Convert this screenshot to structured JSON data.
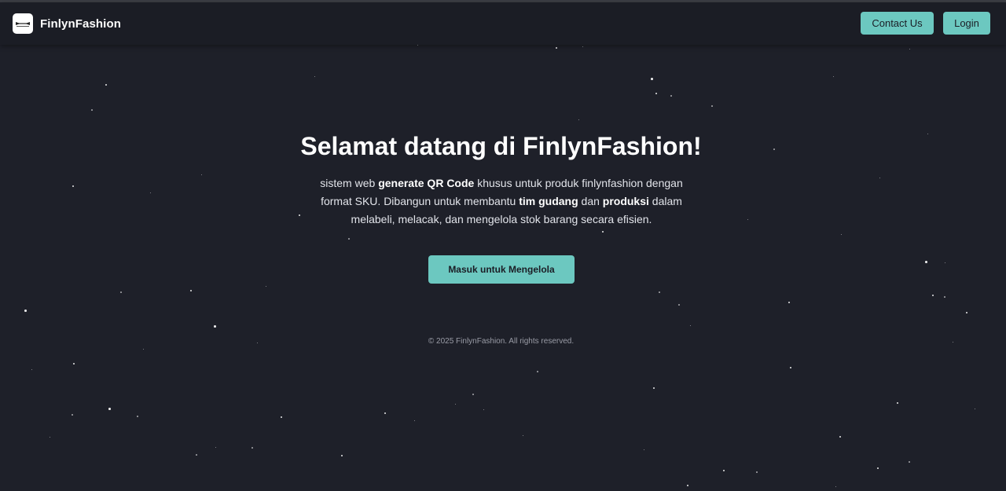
{
  "navbar": {
    "brand_name": "FinlynFashion",
    "logo_icon": "brand-logo-icon",
    "contact_label": "Contact Us",
    "login_label": "Login"
  },
  "hero": {
    "title": "Selamat datang di FinlynFashion!",
    "desc": {
      "t1": "sistem web ",
      "b1": "generate QR Code",
      "t2": " khusus untuk produk finlynfashion dengan format SKU. Dibangun untuk membantu ",
      "b2": "tim gudang",
      "t3": " dan ",
      "b3": "produksi",
      "t4": " dalam melabeli, melacak, dan mengelola stok barang secara efisien."
    },
    "cta_label": "Masuk untuk Mengelola"
  },
  "footer": {
    "copyright": "© 2025 FinlynFashion. All rights reserved."
  },
  "colors": {
    "background": "#1e2029",
    "navbar": "#1b1d25",
    "accent": "#6cc8c0",
    "text": "#ffffff"
  }
}
